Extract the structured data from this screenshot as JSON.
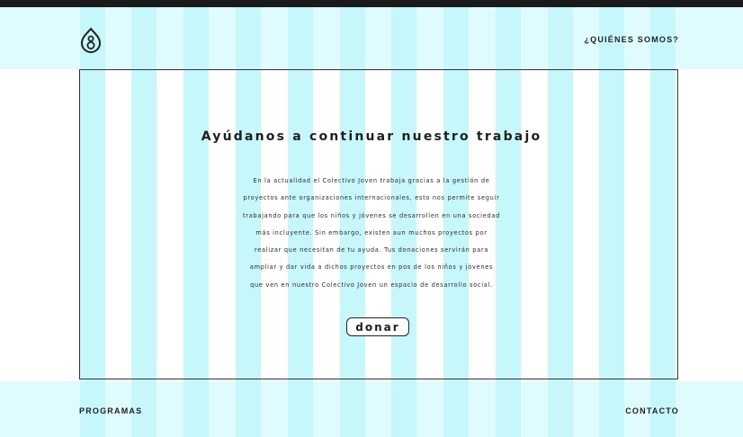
{
  "header": {
    "logo_icon": "droplet-logo-icon",
    "nav_about": "¿QUIÉNES SOMOS?"
  },
  "main": {
    "heading": "Ayúdanos a continuar nuestro trabajo",
    "body_lines": [
      "En la actualidad el Colectivo Joven trabaja gracias a la gestión de",
      "proyectos ante organizaciones internacionales, esto nos permite seguir",
      "trabajando para que los niños y jóvenes se desarrollen en una sociedad",
      "más incluyente. Sin embargo, existen aun muchos proyectos por",
      "realizar que necesitan de tu ayuda. Tus donaciones servirán para",
      "ampliar y dar vida a dichos proyectos en pos de los niños y jóvenes",
      "que ven en nuestro Colectivo Joven un espacio de desarrollo social."
    ],
    "donate_label": "donar"
  },
  "footer": {
    "nav_programs": "PROGRAMAS",
    "nav_contact": "CONTACTO"
  },
  "colors": {
    "stripe": "#c6f7fb",
    "text": "#222222",
    "border": "#333333",
    "top_bar": "#1a1a1a"
  }
}
